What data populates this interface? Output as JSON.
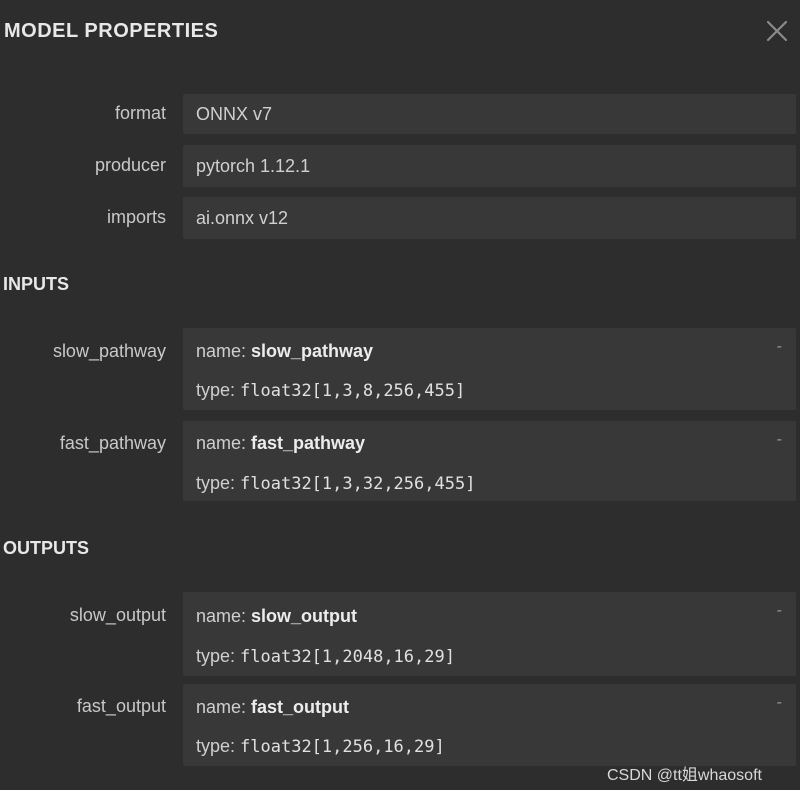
{
  "panel": {
    "title": "MODEL PROPERTIES",
    "close_icon": "close-icon"
  },
  "model": {
    "format_label": "format",
    "format_value": "ONNX v7",
    "producer_label": "producer",
    "producer_value": "pytorch 1.12.1",
    "imports_label": "imports",
    "imports_value": "ai.onnx v12"
  },
  "inputs": {
    "title": "INPUTS",
    "items": [
      {
        "label": "slow_pathway",
        "name_key": "name: ",
        "name": "slow_pathway",
        "type_key": "type: ",
        "type": "float32[1,3,8,256,455]",
        "toggle": "-"
      },
      {
        "label": "fast_pathway",
        "name_key": "name: ",
        "name": "fast_pathway",
        "type_key": "type: ",
        "type": "float32[1,3,32,256,455]",
        "toggle": "-"
      }
    ]
  },
  "outputs": {
    "title": "OUTPUTS",
    "items": [
      {
        "label": "slow_output",
        "name_key": "name: ",
        "name": "slow_output",
        "type_key": "type: ",
        "type": "float32[1,2048,16,29]",
        "toggle": "-"
      },
      {
        "label": "fast_output",
        "name_key": "name: ",
        "name": "fast_output",
        "type_key": "type: ",
        "type": "float32[1,256,16,29]",
        "toggle": "-"
      }
    ]
  },
  "watermark": "CSDN @tt姐whaosoft",
  "colors": {
    "background": "#2d2d2d",
    "value_box": "#383838",
    "text": "#d4d4d4",
    "heading": "#e8e8e8"
  }
}
